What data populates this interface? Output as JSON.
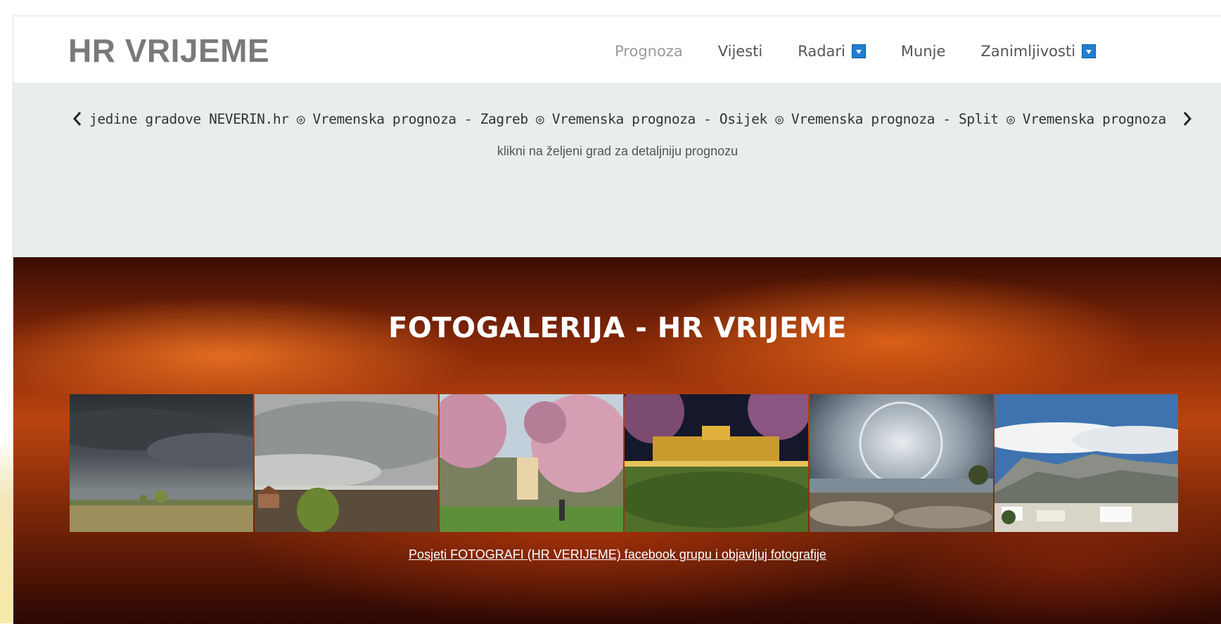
{
  "header": {
    "brand": "HR VRIJEME",
    "nav": [
      {
        "label": "Prognoza",
        "dropdown": false,
        "active": true
      },
      {
        "label": "Vijesti",
        "dropdown": false
      },
      {
        "label": "Radari",
        "dropdown": true
      },
      {
        "label": "Munje",
        "dropdown": false
      },
      {
        "label": "Zanimljivosti",
        "dropdown": true
      }
    ]
  },
  "ticker": {
    "text": "jedine gradove NEVERIN.hr ◎ Vremenska prognoza - Zagreb ◎ Vremenska prognoza - Osijek ◎ Vremenska prognoza - Split ◎ Vremenska prognoza - Rijeka",
    "prev_icon": "chevron-left-icon",
    "next_icon": "chevron-right-icon",
    "subtitle": "klikni na željeni grad za detaljniju prognozu"
  },
  "gallery": {
    "title": "FOTOGALERIJA - HR VRIJEME",
    "photos": [
      {
        "subject": "storm clouds over field"
      },
      {
        "subject": "grey overcast sky over village"
      },
      {
        "subject": "blossoming pink trees in park"
      },
      {
        "subject": "night park with magnolia trees and lit building"
      },
      {
        "subject": "halo over rocky coast"
      },
      {
        "subject": "mountains and coastal town under clouds"
      }
    ],
    "link": "Posjeti FOTOGRAFI (HR VERIJEME) facebook grupu i objavljuj fotografije"
  },
  "colors": {
    "brand": "#7a7a7a",
    "ticker_bg": "#e8eeeb",
    "dropdown_icon": "#1f7fd1",
    "gallery_bg": "#b9440f"
  }
}
